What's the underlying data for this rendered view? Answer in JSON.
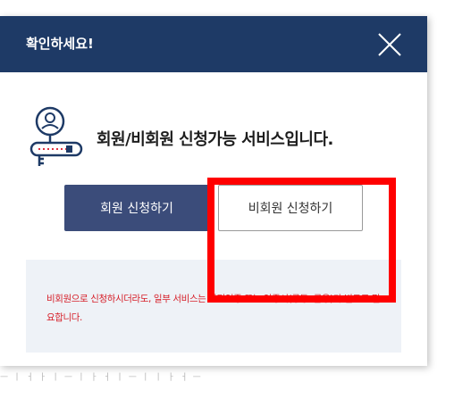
{
  "background": {
    "faint_text": "ㅡ ㅣ ㅓ ㅏ ㅣ ㅡ ㅣ ㅏ ㅓ ㅣ ㅡ ㅣ ㅣ ㅏ ㅓ ㅡ"
  },
  "modal": {
    "title": "확인하세요!",
    "close_icon": "close-icon",
    "info_icon": "member-key-icon",
    "info_text": "회원/비회원 신청가능 서비스입니다.",
    "member_button_label": "회원 신청하기",
    "nonmember_button_label": "비회원 신청하기",
    "notice_text": "비회원으로 신청하시더라도, 일부 서비스는 간편인증 또는 인증서(공동, 금융)가 별도로 필요합니다."
  },
  "colors": {
    "header": "#1e3a66",
    "member_button": "#3b4c7a",
    "notice_text": "#d6202a",
    "notice_bg": "#eef2f7",
    "highlight": "#ff0000"
  }
}
